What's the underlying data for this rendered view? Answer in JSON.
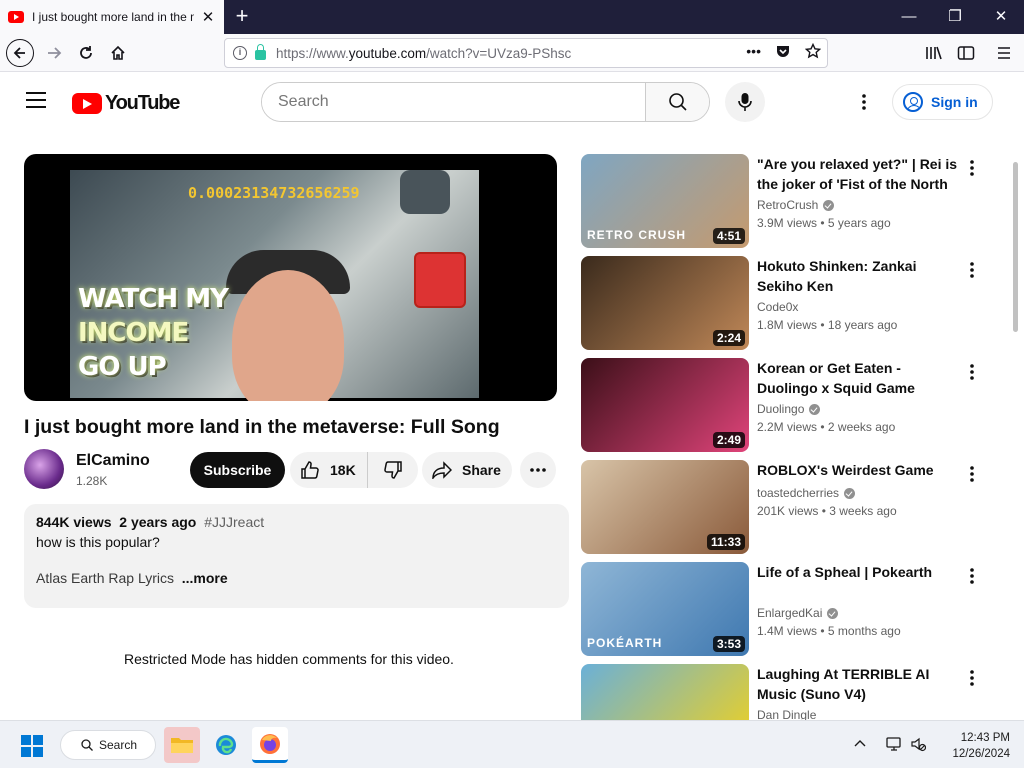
{
  "browser": {
    "tab_title": "I just bought more land in the metaverse: Full Song - YouTube",
    "url_prefix": "https://www.",
    "url_domain": "youtube.com",
    "url_path": "/watch?v=UVza9-PShsc"
  },
  "header": {
    "logo_text": "YouTube",
    "search_placeholder": "Search",
    "signin_label": "Sign in"
  },
  "player": {
    "counter": "0.00023134732656259",
    "overlay_line1": "WATCH MY",
    "overlay_line2": "INCOME",
    "overlay_line3": "GO UP"
  },
  "video": {
    "title": "I just bought more land in the metaverse: Full Song",
    "channel": "ElCamino",
    "subscribers": "1.28K",
    "subscribe_label": "Subscribe",
    "likes": "18K",
    "share_label": "Share",
    "views": "844K views",
    "age": "2 years ago",
    "hashtag": "#JJJreact",
    "desc_line1": "how is this popular?",
    "desc_line2": "Atlas Earth Rap Lyrics",
    "more_label": "...more",
    "restricted_notice": "Restricted Mode has hidden comments for this video."
  },
  "recommendations": [
    {
      "title": "\"Are you relaxed yet?\" | Rei is the joker of 'Fist of the North",
      "channel": "RetroCrush",
      "verified": true,
      "views": "3.9M views",
      "age": "5 years ago",
      "duration": "4:51",
      "thumb_colors": [
        "#7fa6c2",
        "#c59a6e"
      ],
      "thumb_label": "RETRO CRUSH"
    },
    {
      "title": "Hokuto Shinken: Zankai Sekiho Ken",
      "channel": "Code0x",
      "verified": false,
      "views": "1.8M views",
      "age": "18 years ago",
      "duration": "2:24",
      "thumb_colors": [
        "#3a2a1c",
        "#c08858"
      ],
      "thumb_label": ""
    },
    {
      "title": "Korean or Get Eaten - Duolingo x Squid Game",
      "channel": "Duolingo",
      "verified": true,
      "views": "2.2M views",
      "age": "2 weeks ago",
      "duration": "2:49",
      "thumb_colors": [
        "#3b0f18",
        "#e0447a"
      ],
      "thumb_label": ""
    },
    {
      "title": "ROBLOX's Weirdest Game",
      "channel": "toastedcherries",
      "verified": true,
      "views": "201K views",
      "age": "3 weeks ago",
      "duration": "11:33",
      "thumb_colors": [
        "#d8c4a8",
        "#8a5a3a"
      ],
      "thumb_label": ""
    },
    {
      "title": "Life of a Spheal | Pokearth",
      "channel": "EnlargedKai",
      "verified": true,
      "views": "1.4M views",
      "age": "5 months ago",
      "duration": "3:53",
      "thumb_colors": [
        "#8fb6d6",
        "#3f78b0"
      ],
      "thumb_label": "POKÉARTH"
    },
    {
      "title": "Laughing At TERRIBLE AI Music (Suno V4)",
      "channel": "Dan Dingle",
      "verified": false,
      "views": "",
      "age": "",
      "duration": "",
      "thumb_colors": [
        "#6ab0d8",
        "#f3d21a"
      ],
      "thumb_label": ""
    }
  ],
  "taskbar": {
    "search_label": "Search",
    "time": "12:43 PM",
    "date": "12/26/2024"
  }
}
